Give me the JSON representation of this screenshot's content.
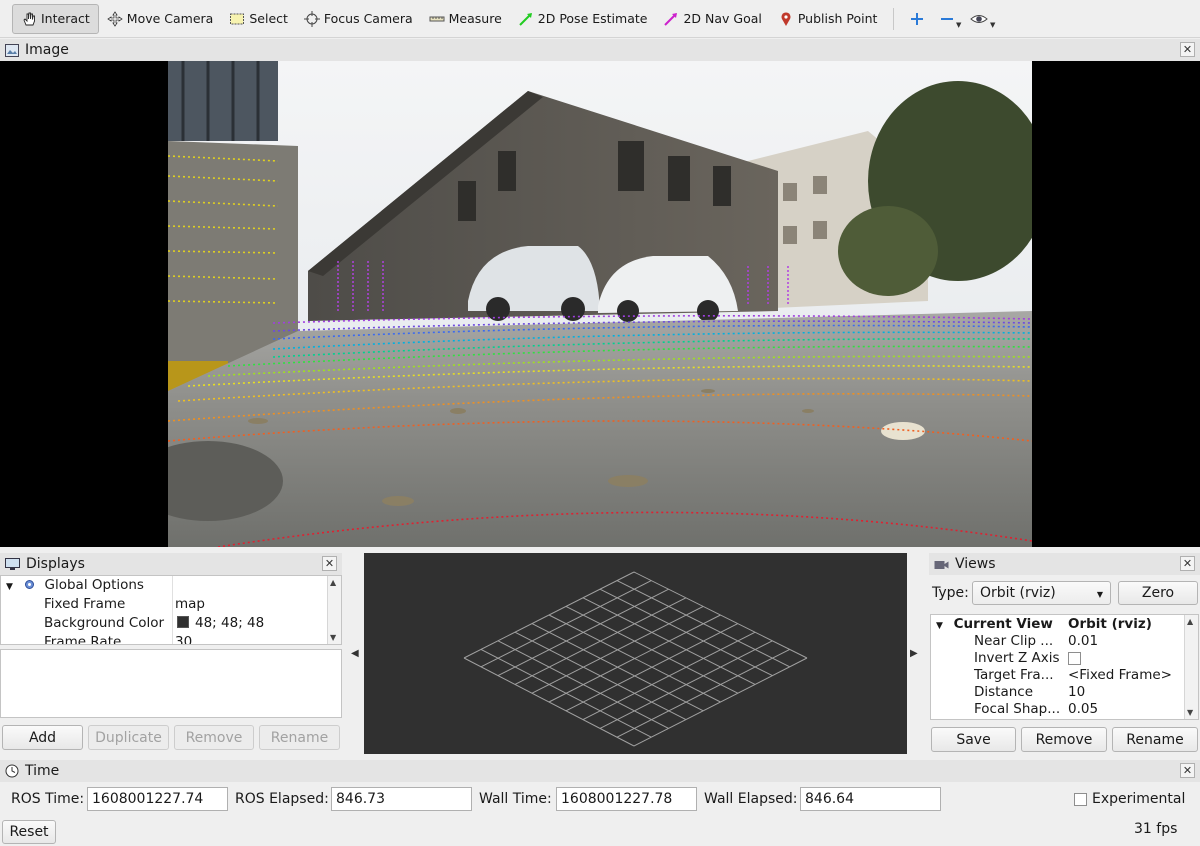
{
  "toolbar": {
    "tools": [
      {
        "label": "Interact",
        "icon": "hand-icon"
      },
      {
        "label": "Move Camera",
        "icon": "move-arrows-icon"
      },
      {
        "label": "Select",
        "icon": "select-rect-icon"
      },
      {
        "label": "Focus Camera",
        "icon": "crosshair-icon"
      },
      {
        "label": "Measure",
        "icon": "ruler-icon"
      },
      {
        "label": "2D Pose Estimate",
        "icon": "green-arrow-icon"
      },
      {
        "label": "2D Nav Goal",
        "icon": "magenta-arrow-icon"
      },
      {
        "label": "Publish Point",
        "icon": "map-pin-icon"
      }
    ],
    "colors": {
      "pose": "#22cc22",
      "nav": "#cc22cc",
      "pin": "#c0392b",
      "plus": "#2a7ad8"
    }
  },
  "image_panel": {
    "title": "Image"
  },
  "displays": {
    "title": "Displays",
    "global_options": "Global Options",
    "rows": [
      {
        "name": "Fixed Frame",
        "value": "map"
      },
      {
        "name": "Background Color",
        "value": "48; 48; 48"
      },
      {
        "name": "Frame Rate",
        "value": "30"
      }
    ],
    "buttons": {
      "add": "Add",
      "duplicate": "Duplicate",
      "remove": "Remove",
      "rename": "Rename"
    }
  },
  "views": {
    "title": "Views",
    "type_label": "Type:",
    "type_value": "Orbit (rviz)",
    "zero": "Zero",
    "current_view": "Current View",
    "current_view_value": "Orbit (rviz)",
    "rows": [
      {
        "name": "Near Clip ...",
        "value": "0.01"
      },
      {
        "name": "Invert Z Axis",
        "value": ""
      },
      {
        "name": "Target Fra...",
        "value": "<Fixed Frame>"
      },
      {
        "name": "Distance",
        "value": "10"
      },
      {
        "name": "Focal Shap...",
        "value": "0.05"
      }
    ],
    "buttons": {
      "save": "Save",
      "remove": "Remove",
      "rename": "Rename"
    }
  },
  "time": {
    "title": "Time",
    "ros_time_label": "ROS Time:",
    "ros_time": "1608001227.74",
    "ros_elapsed_label": "ROS Elapsed:",
    "ros_elapsed": "846.73",
    "wall_time_label": "Wall Time:",
    "wall_time": "1608001227.78",
    "wall_elapsed_label": "Wall Elapsed:",
    "wall_elapsed": "846.64",
    "experimental": "Experimental",
    "reset": "Reset",
    "fps": "31 fps"
  }
}
